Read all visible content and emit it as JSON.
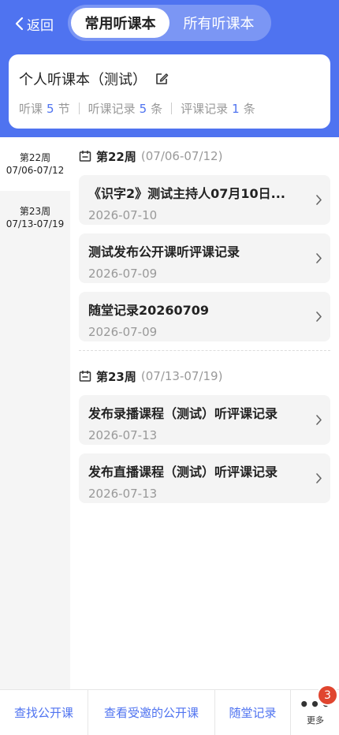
{
  "header": {
    "back_label": "返回",
    "tabs": [
      {
        "label": "常用听课本",
        "active": true
      },
      {
        "label": "所有听课本",
        "active": false
      }
    ],
    "accent_color": "#4f73f0"
  },
  "notebook": {
    "title": "个人听课本（测试）",
    "stats": [
      {
        "prefix": "听课",
        "value": "5",
        "unit": "节"
      },
      {
        "prefix": "听课记录",
        "value": "5",
        "unit": "条"
      },
      {
        "prefix": "评课记录",
        "value": "1",
        "unit": "条"
      }
    ]
  },
  "sidebar": {
    "items": [
      {
        "week": "第22周",
        "range": "07/06-07/12",
        "active": true
      },
      {
        "week": "第23周",
        "range": "07/13-07/19",
        "active": false
      }
    ]
  },
  "weeks": [
    {
      "title": "第22周",
      "range": "(07/06-07/12)",
      "records": [
        {
          "title": "《识字2》测试主持人07月10日...",
          "date": "2026-07-10"
        },
        {
          "title": "测试发布公开课听评课记录",
          "date": "2026-07-09"
        },
        {
          "title": "随堂记录20260709",
          "date": "2026-07-09"
        }
      ]
    },
    {
      "title": "第23周",
      "range": "(07/13-07/19)",
      "records": [
        {
          "title": "发布录播课程（测试）听评课记录",
          "date": "2026-07-13"
        },
        {
          "title": "发布直播课程（测试）听评课记录",
          "date": "2026-07-13"
        }
      ]
    }
  ],
  "bottom_bar": {
    "items": [
      "查找公开课",
      "查看受邀的公开课",
      "随堂记录"
    ],
    "more_label": "更多",
    "more_badge": "3"
  }
}
